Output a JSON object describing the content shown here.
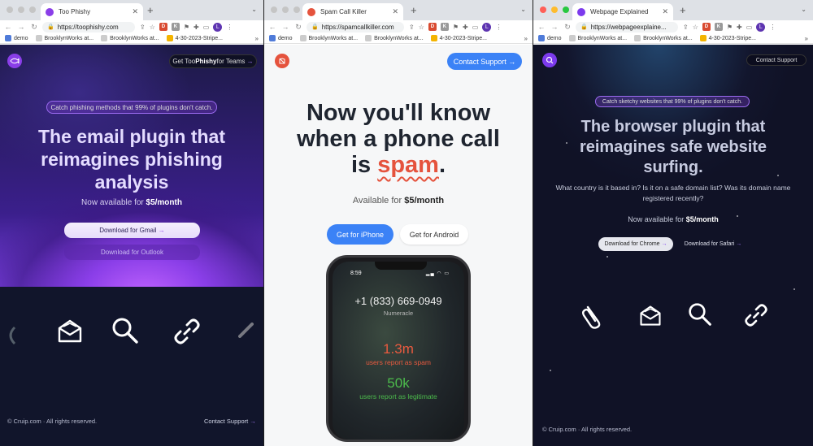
{
  "windows": [
    {
      "tab_title": "Too Phishy",
      "url": "https://toophishy.com",
      "bookmarks": [
        "demo",
        "BrooklynWorks at...",
        "BrooklynWorks at...",
        "4-30-2023-Stripe..."
      ],
      "nav_button": {
        "prefix": "Get Too",
        "bold": "Phishy",
        "suffix": " for Teams",
        "arrow": "→"
      },
      "badge": "Catch phishing methods that 99% of plugins don't catch.",
      "headline": [
        "The email plugin that",
        "reimagines phishing",
        "analysis"
      ],
      "price_prefix": "Now available for ",
      "price": "$5/month",
      "primary_button": "Download for Gmail",
      "secondary_button": "Download for Outlook",
      "arrow": "→",
      "icons": [
        "envelope-icon",
        "search-icon",
        "link-icon"
      ],
      "footer_left": "© Cruip.com · All rights reserved.",
      "footer_right": "Contact Support",
      "colors": {
        "accent": "#8a3ee8",
        "hero_glow": "#c264ff"
      }
    },
    {
      "tab_title": "Spam Call Killer",
      "url": "https://spamcallkiller.com",
      "bookmarks": [
        "demo",
        "BrooklynWorks at...",
        "BrooklynWorks at...",
        "4-30-2023-Stripe..."
      ],
      "nav_button": "Contact Support",
      "arrow": "→",
      "headline_line1": "Now you'll know",
      "headline_line2": "when a phone call",
      "headline_is": "is ",
      "headline_spam": "spam",
      "headline_end": ".",
      "price_prefix": "Available for ",
      "price": "$5/month",
      "primary_button": "Get for iPhone",
      "secondary_button": "Get for Android",
      "phone": {
        "time": "8:59",
        "number": "+1 (833) 669-0949",
        "caller": "Numeracle",
        "stat1_value": "1.3m",
        "stat1_label": "users report as spam",
        "stat2_value": "50k",
        "stat2_label": "users report as legitimate"
      },
      "colors": {
        "accent": "#3b82f6",
        "spam": "#e5533d",
        "legit": "#4cbb4c"
      }
    },
    {
      "tab_title": "Webpage Explained",
      "url": "https://webpageexplaine...",
      "bookmarks": [
        "demo",
        "BrooklynWorks at...",
        "BrooklynWorks at...",
        "4-30-2023-Stripe..."
      ],
      "nav_button": "Contact Support",
      "badge": "Catch sketchy websites that 99% of plugins don't catch.",
      "headline": [
        "The browser plugin that",
        "reimagines safe website",
        "surfing."
      ],
      "description": [
        "What country is it based in? Is it on a safe domain list? Was its domain name",
        "registered recently?"
      ],
      "price_prefix": "Now available for ",
      "price": "$5/month",
      "primary_button": "Download for Chrome",
      "secondary_button": "Download for Safari",
      "arrow": "→",
      "icons": [
        "paperclip-icon",
        "envelope-icon",
        "search-icon",
        "link-icon"
      ],
      "footer_left": "© Cruip.com · All rights reserved.",
      "colors": {
        "accent": "#7c3aed"
      }
    }
  ]
}
